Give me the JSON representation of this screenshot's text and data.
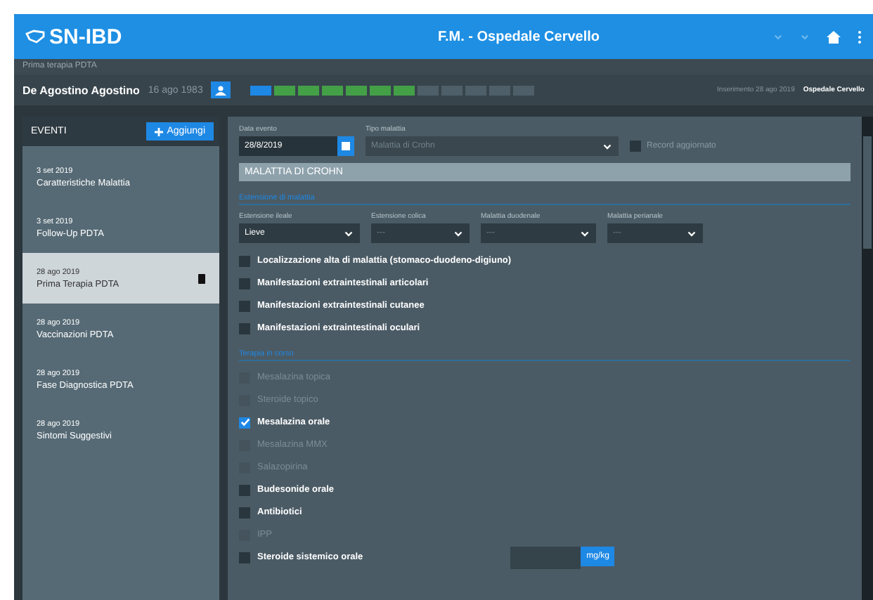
{
  "header": {
    "logo": "SN-IBD",
    "title": "F.M. - Ospedale Cervello"
  },
  "breadcrumb": "Prima terapia PDTA",
  "patient": {
    "name": "De Agostino Agostino",
    "birth_date": "16 ago 1983",
    "inserted": "Inserimento 28 ago 2019",
    "hospital": "Ospedale Cervello",
    "tags": [
      {
        "color": "#1e88e5"
      },
      {
        "color": "#43a047"
      },
      {
        "color": "#43a047"
      },
      {
        "color": "#43a047"
      },
      {
        "color": "#43a047"
      },
      {
        "color": "#43a047"
      },
      {
        "color": "#43a047"
      },
      {
        "color": "#4f5f69"
      },
      {
        "color": "#4f5f69"
      },
      {
        "color": "#4f5f69"
      },
      {
        "color": "#4f5f69"
      },
      {
        "color": "#4f5f69"
      }
    ]
  },
  "sidebar": {
    "title": "EVENTI",
    "add_button": "Aggiungi",
    "events": [
      {
        "date": "3 set 2019",
        "name": "Caratteristiche Malattia",
        "selected": false
      },
      {
        "date": "3 set 2019",
        "name": "Follow-Up PDTA",
        "selected": false
      },
      {
        "date": "28 ago 2019",
        "name": "Prima Terapia PDTA",
        "selected": true
      },
      {
        "date": "28 ago 2019",
        "name": "Vaccinazioni PDTA",
        "selected": false
      },
      {
        "date": "28 ago 2019",
        "name": "Fase Diagnostica PDTA",
        "selected": false
      },
      {
        "date": "28 ago 2019",
        "name": "Sintomi Suggestivi",
        "selected": false
      }
    ]
  },
  "form": {
    "event_date": {
      "label": "Data evento",
      "value": "28/8/2019"
    },
    "disease_type": {
      "label": "Tipo malattia",
      "placeholder": "Malattia di Crohn"
    },
    "record_check": {
      "label": "Record aggiornato",
      "checked": false
    },
    "section_title": "MALATTIA DI CROHN",
    "groups": [
      {
        "title": "Estensione di malattia",
        "selects": [
          {
            "label": "Estensione ileale",
            "value": "Lieve"
          },
          {
            "label": "Estensione colica",
            "placeholder": "---"
          },
          {
            "label": "Malattia duodenale",
            "placeholder": "---"
          },
          {
            "label": "Malattia perianale",
            "placeholder": "---"
          }
        ],
        "checks": [
          {
            "kind": "check",
            "label": "Localizzazione alta di malattia (stomaco-duodeno-digiuno)",
            "checked": false,
            "disabled": false
          },
          {
            "kind": "check",
            "label": "Manifestazioni extraintestinali articolari",
            "checked": false,
            "disabled": false
          },
          {
            "kind": "check",
            "label": "Manifestazioni extraintestinali cutanee",
            "checked": false,
            "disabled": false
          },
          {
            "kind": "check",
            "label": "Manifestazioni extraintestinali oculari",
            "checked": false,
            "disabled": false
          }
        ]
      },
      {
        "title": "Terapia in corso",
        "checks": [
          {
            "kind": "check",
            "label": "Mesalazina topica",
            "checked": false,
            "disabled": true
          },
          {
            "kind": "check",
            "label": "Steroide topico",
            "checked": false,
            "disabled": true
          },
          {
            "kind": "check",
            "label": "Mesalazina orale",
            "checked": true,
            "disabled": false
          },
          {
            "kind": "check",
            "label": "Mesalazina MMX",
            "checked": false,
            "disabled": true
          },
          {
            "kind": "check",
            "label": "Salazopirina",
            "checked": false,
            "disabled": true
          },
          {
            "kind": "check",
            "label": "Budesonide orale",
            "checked": false,
            "disabled": false
          },
          {
            "kind": "check",
            "label": "Antibiotici",
            "checked": false,
            "disabled": false
          },
          {
            "kind": "check",
            "label": "IPP",
            "checked": false,
            "disabled": true
          },
          {
            "kind": "dose",
            "label": "Steroide sistemico orale",
            "checked": false,
            "disabled": false,
            "unit": "mg/kg"
          }
        ]
      }
    ]
  }
}
